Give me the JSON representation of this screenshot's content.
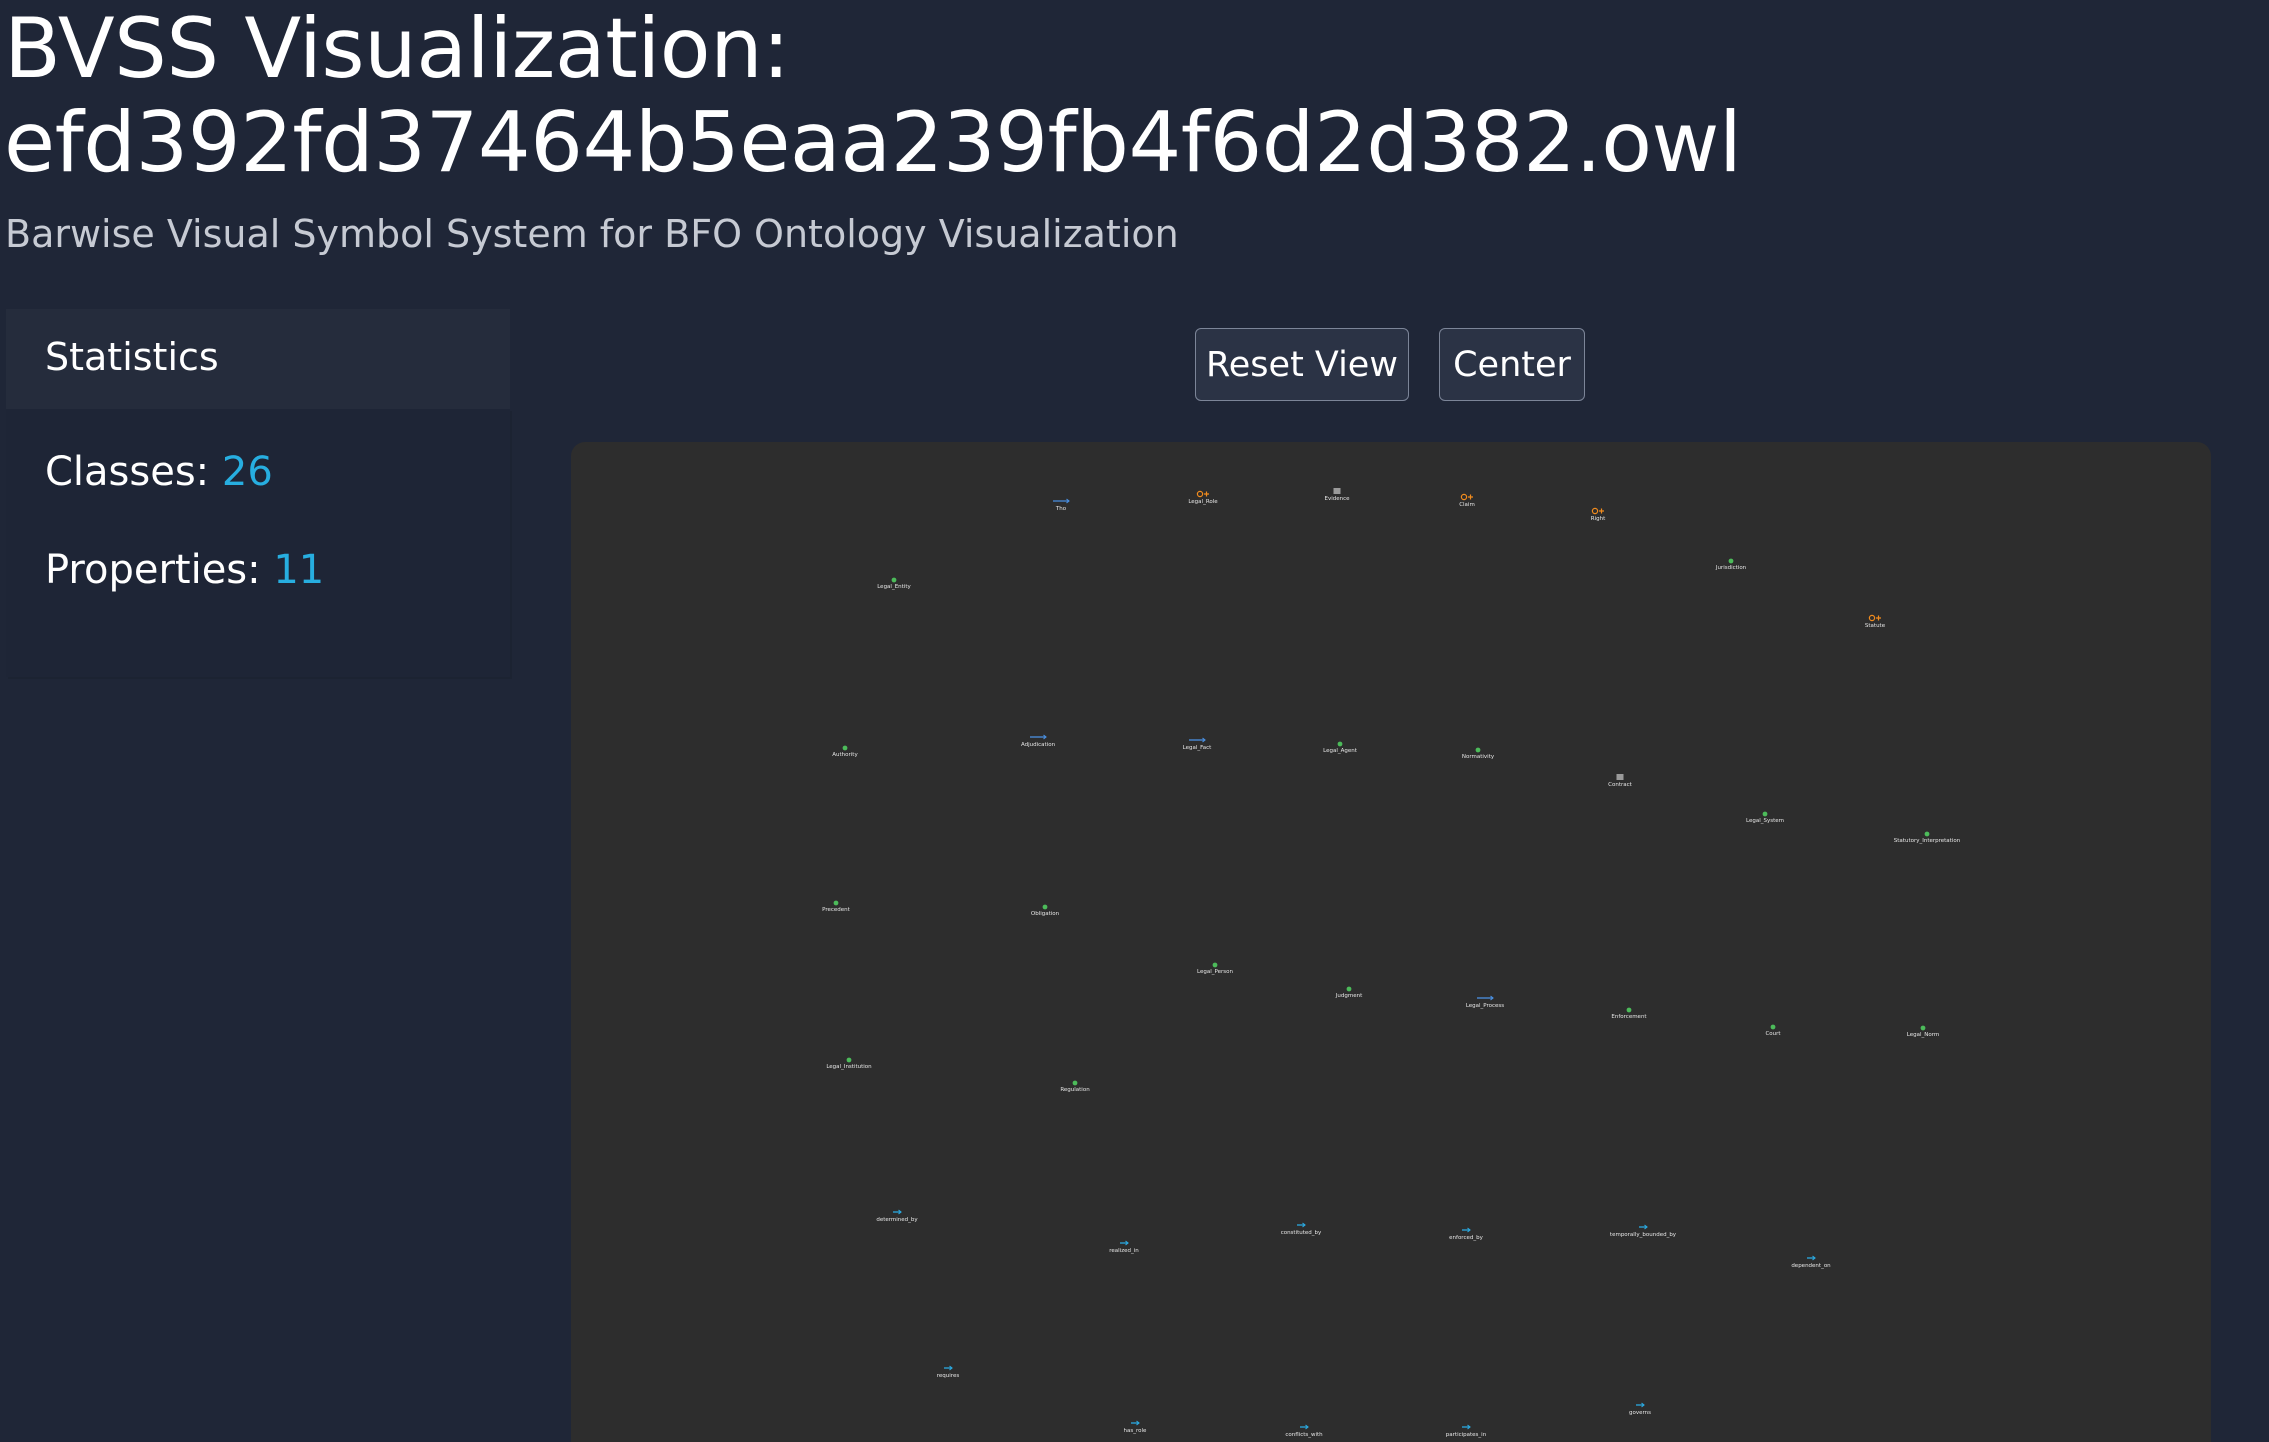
{
  "header": {
    "title_line1": "BVSS Visualization:",
    "title_line2": "efd392fd37464b5eaa239fb4f6d2d382.owl",
    "subtitle": "Barwise Visual Symbol System for BFO Ontology Visualization"
  },
  "sidebar": {
    "heading": "Statistics",
    "classes_label": "Classes:",
    "classes_value": "26",
    "properties_label": "Properties:",
    "properties_value": "11"
  },
  "toolbar": {
    "reset_label": "Reset View",
    "center_label": "Center"
  },
  "colors": {
    "continuant": "#4cbb5a",
    "process": "#4a90e2",
    "role": "#f28c1e",
    "property": "#2ba9e0",
    "gdc": "#9a9a9a"
  },
  "graph": {
    "nodes": [
      {
        "label": "Tho",
        "kind": "process"
      },
      {
        "label": "Legal_Role",
        "kind": "role"
      },
      {
        "label": "Evidence",
        "kind": "gdc"
      },
      {
        "label": "Claim",
        "kind": "role"
      },
      {
        "label": "Right",
        "kind": "role"
      },
      {
        "label": "Jurisdiction",
        "kind": "continuant"
      },
      {
        "label": "Legal_Entity",
        "kind": "continuant"
      },
      {
        "label": "Statute",
        "kind": "role"
      },
      {
        "label": "Authority",
        "kind": "continuant"
      },
      {
        "label": "Adjudication",
        "kind": "process"
      },
      {
        "label": "Legal_Fact",
        "kind": "process"
      },
      {
        "label": "Legal_Agent",
        "kind": "continuant"
      },
      {
        "label": "Normativity",
        "kind": "continuant"
      },
      {
        "label": "Contract",
        "kind": "gdc"
      },
      {
        "label": "Legal_System",
        "kind": "continuant"
      },
      {
        "label": "Statutory_Interpretation",
        "kind": "continuant"
      },
      {
        "label": "Precedent",
        "kind": "continuant"
      },
      {
        "label": "Obligation",
        "kind": "continuant"
      },
      {
        "label": "Legal_Person",
        "kind": "continuant"
      },
      {
        "label": "Judgment",
        "kind": "continuant"
      },
      {
        "label": "Legal_Process",
        "kind": "process"
      },
      {
        "label": "Enforcement",
        "kind": "continuant"
      },
      {
        "label": "Court",
        "kind": "continuant"
      },
      {
        "label": "Legal_Norm",
        "kind": "continuant"
      },
      {
        "label": "Legal_Institution",
        "kind": "continuant"
      },
      {
        "label": "Regulation",
        "kind": "continuant"
      },
      {
        "label": "determined_by",
        "kind": "property"
      },
      {
        "label": "realized_in",
        "kind": "property"
      },
      {
        "label": "constituted_by",
        "kind": "property"
      },
      {
        "label": "enforced_by",
        "kind": "property"
      },
      {
        "label": "temporally_bounded_by",
        "kind": "property"
      },
      {
        "label": "dependent_on",
        "kind": "property"
      },
      {
        "label": "requires",
        "kind": "property"
      },
      {
        "label": "has_role",
        "kind": "property"
      },
      {
        "label": "conflicts_with",
        "kind": "property"
      },
      {
        "label": "participates_in",
        "kind": "property"
      },
      {
        "label": "governs",
        "kind": "property"
      }
    ]
  }
}
